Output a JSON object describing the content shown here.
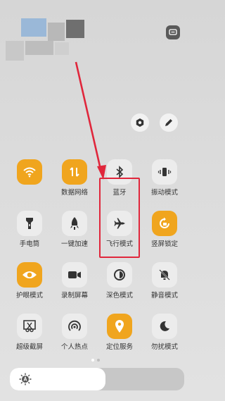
{
  "colors": {
    "accent_on": "#f0a51e",
    "tile_off": "#ececec",
    "highlight": "#e0263b"
  },
  "tiles": [
    {
      "label": "",
      "icon": "wifi-icon",
      "on": true
    },
    {
      "label": "数据网络",
      "icon": "mobile-data-icon",
      "on": true
    },
    {
      "label": "蓝牙",
      "icon": "bluetooth-icon",
      "on": false
    },
    {
      "label": "振动模式",
      "icon": "vibrate-icon",
      "on": false
    },
    {
      "label": "手电筒",
      "icon": "flashlight-icon",
      "on": false
    },
    {
      "label": "一键加速",
      "icon": "rocket-icon",
      "on": false
    },
    {
      "label": "飞行模式",
      "icon": "airplane-icon",
      "on": false
    },
    {
      "label": "竖屏锁定",
      "icon": "rotation-lock-icon",
      "on": true
    },
    {
      "label": "护眼模式",
      "icon": "eye-icon",
      "on": true
    },
    {
      "label": "录制屏幕",
      "icon": "video-camera-icon",
      "on": false
    },
    {
      "label": "深色模式",
      "icon": "dark-mode-icon",
      "on": false
    },
    {
      "label": "静音模式",
      "icon": "bell-off-icon",
      "on": false
    },
    {
      "label": "超级截屏",
      "icon": "screenshot-icon",
      "on": false
    },
    {
      "label": "个人热点",
      "icon": "hotspot-icon",
      "on": false
    },
    {
      "label": "定位服务",
      "icon": "location-icon",
      "on": true
    },
    {
      "label": "勿扰模式",
      "icon": "moon-icon",
      "on": false
    }
  ],
  "brightness": {
    "level": 0.55,
    "icon": "brightness-auto-icon"
  },
  "pager": {
    "pages": 2,
    "active": 1
  }
}
